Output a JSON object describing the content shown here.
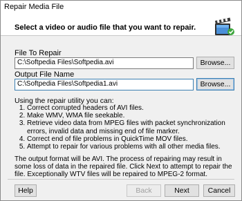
{
  "window": {
    "title": "Repair Media File"
  },
  "header": {
    "instruction": "Select a video or audio file that you want to repair."
  },
  "file_to_repair": {
    "label": "File To Repair",
    "value": "C:\\Softpedia Files\\Softpedia.avi",
    "browse_label": "Browse..."
  },
  "output_file": {
    "label": "Output File Name",
    "value": "C:\\Softpedia Files\\Softpedia1.avi",
    "browse_label": "Browse..."
  },
  "info": {
    "intro": "Using the repair utility you can:",
    "items": [
      "Correct corrupted headers of AVI files.",
      "Make WMV, WMA file seekable.",
      "Retrieve video data from MPEG files with packet synchronization errors, invalid data and missing end of file marker.",
      "Correct end of file problems in QuickTime MOV files.",
      "Attempt to repair for various problems with all other media files."
    ],
    "output_note": "The output format will be AVI. The process of repairing may result in some loss of data in the repaired file.  Click Next to attempt to repair the file. Exceptionally WTV files will be repaired to MPEG-2 format."
  },
  "footer": {
    "help_label": "Help",
    "back_label": "Back",
    "next_label": "Next",
    "cancel_label": "Cancel"
  },
  "icons": {
    "header": "film-repair-icon"
  },
  "colors": {
    "header_bg": "#ffffff",
    "dialog_bg": "#f0f0f0",
    "focus_border": "#3c7fb1"
  }
}
